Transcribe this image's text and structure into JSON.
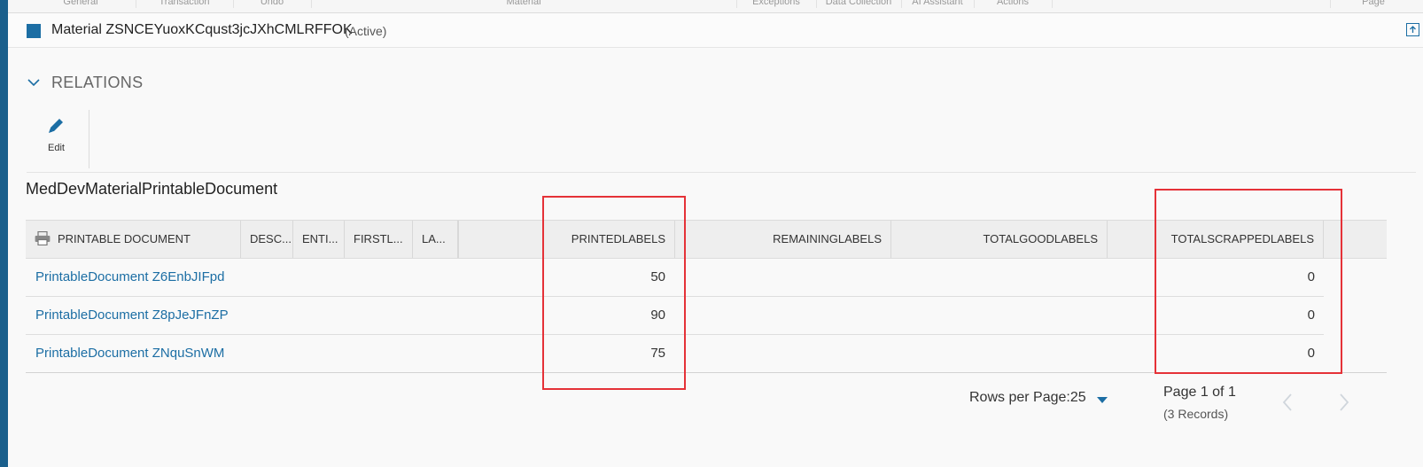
{
  "ribbon": {
    "tabs": [
      "General",
      "Transaction",
      "Undo",
      "Material",
      "Exceptions",
      "Data Collection",
      "AI Assistant",
      "Actions",
      "Page"
    ]
  },
  "header": {
    "title": "Material ZSNCEYuoxKCqust3jcJXhCMLRFFOK",
    "status": "(Active)"
  },
  "section": {
    "title": "RELATIONS"
  },
  "toolbar": {
    "edit_label": "Edit"
  },
  "table": {
    "title": "MedDevMaterialPrintableDocument",
    "columns": [
      "PRINTABLE DOCUMENT",
      "DESC...",
      "ENTI...",
      "FIRSTL...",
      "LA...",
      "PRINTEDLABELS",
      "REMAININGLABELS",
      "TOTALGOODLABELS",
      "TOTALSCRAPPEDLABELS"
    ],
    "rows": [
      {
        "name": "PrintableDocument Z6EnbJIFpd",
        "printed": "50",
        "remaining": "",
        "good": "",
        "scrapped": "0"
      },
      {
        "name": "PrintableDocument Z8pJeJFnZP",
        "printed": "90",
        "remaining": "",
        "good": "",
        "scrapped": "0"
      },
      {
        "name": "PrintableDocument ZNquSnWM",
        "printed": "75",
        "remaining": "",
        "good": "",
        "scrapped": "0"
      }
    ]
  },
  "pager": {
    "rows_per_page": "Rows per Page:25",
    "page_info": "Page 1 of 1",
    "records": "(3 Records)"
  },
  "colors": {
    "accent": "#1c6ea4",
    "highlight": "#e53238"
  },
  "icons": [
    "expand-icon",
    "chevron-down-icon",
    "pencil-icon",
    "printer-icon",
    "caret-down-icon",
    "chevron-left-icon",
    "chevron-right-icon"
  ]
}
